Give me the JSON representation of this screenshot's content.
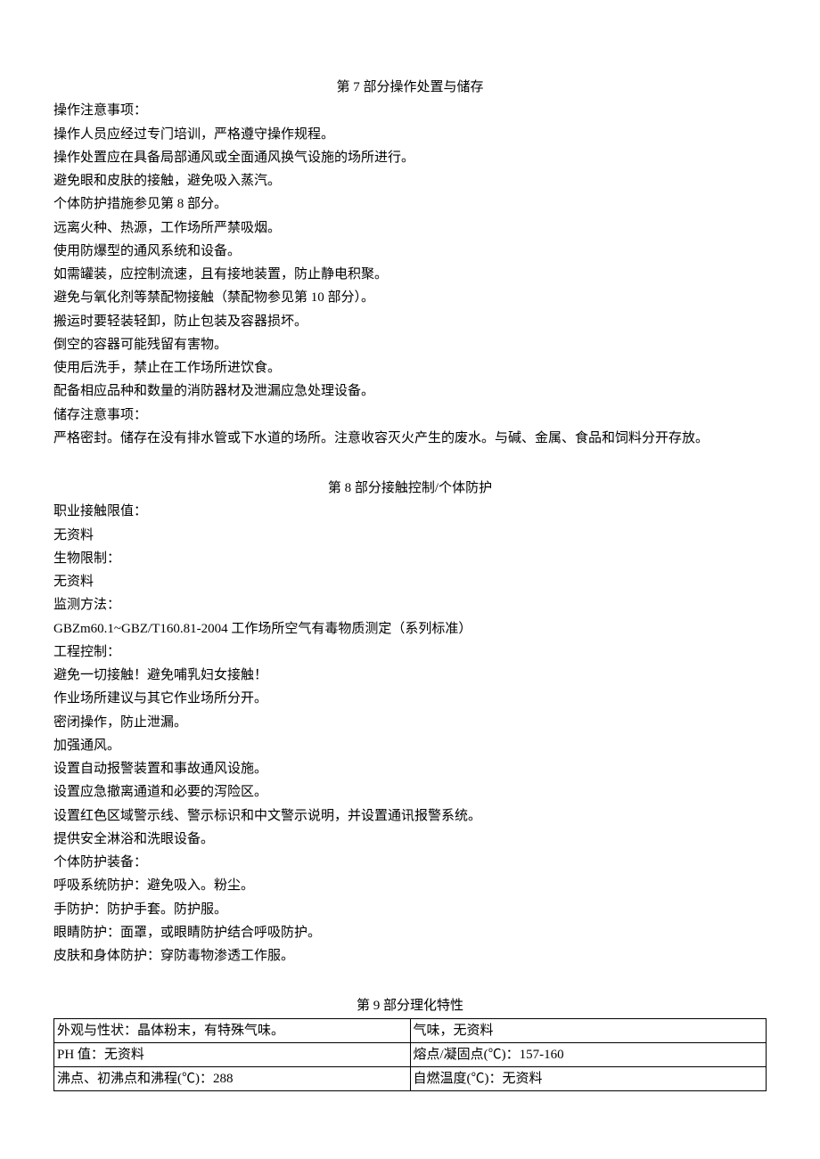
{
  "section7": {
    "title": "第 7 部分操作处置与储存",
    "lines": [
      "操作注意事项：",
      "操作人员应经过专门培训，严格遵守操作规程。",
      "操作处置应在具备局部通风或全面通风换气设施的场所进行。",
      "避免眼和皮肤的接触，避免吸入蒸汽。",
      "个体防护措施参见第 8 部分。",
      "远离火种、热源，工作场所严禁吸烟。",
      "使用防爆型的通风系统和设备。",
      "如需罐装，应控制流速，且有接地装置，防止静电积聚。",
      "避免与氧化剂等禁配物接触（禁配物参见第 10 部分）。",
      "搬运时要轻装轻卸，防止包装及容器损坏。",
      "倒空的容器可能残留有害物。",
      "使用后洗手，禁止在工作场所进饮食。",
      "配备相应品种和数量的消防器材及泄漏应急处理设备。",
      "储存注意事项：",
      "严格密封。储存在没有排水管或下水道的场所。注意收容灭火产生的废水。与碱、金属、食品和饲料分开存放。"
    ]
  },
  "section8": {
    "title": "第 8 部分接触控制/个体防护",
    "lines": [
      "职业接触限值：",
      "无资料",
      "生物限制：",
      "无资料",
      "监测方法：",
      "GBZm60.1~GBZ/T160.81-2004 工作场所空气有毒物质测定（系列标准）",
      "工程控制：",
      "避免一切接触！避免哺乳妇女接触！",
      "作业场所建议与其它作业场所分开。",
      "密闭操作，防止泄漏。",
      "加强通风。",
      "设置自动报警装置和事故通风设施。",
      "设置应急撤离通道和必要的泻险区。",
      "设置红色区域警示线、警示标识和中文警示说明，并设置通讯报警系统。",
      "提供安全淋浴和洗眼设备。",
      "个体防护装备：",
      "呼吸系统防护：避免吸入。粉尘。",
      "手防护：防护手套。防护服。",
      "眼睛防护：面罩，或眼睛防护结合呼吸防护。",
      "皮肤和身体防护：穿防毒物渗透工作服。"
    ]
  },
  "section9": {
    "title": "第 9 部分理化特性",
    "rows": [
      [
        "外观与性状：晶体粉末，有特殊气味。",
        "气味，无资料"
      ],
      [
        "PH 值：无资料",
        "熔点/凝固点(℃)：157-160"
      ],
      [
        "沸点、初沸点和沸程(℃)：288",
        "自燃温度(℃)：无资料"
      ]
    ]
  }
}
